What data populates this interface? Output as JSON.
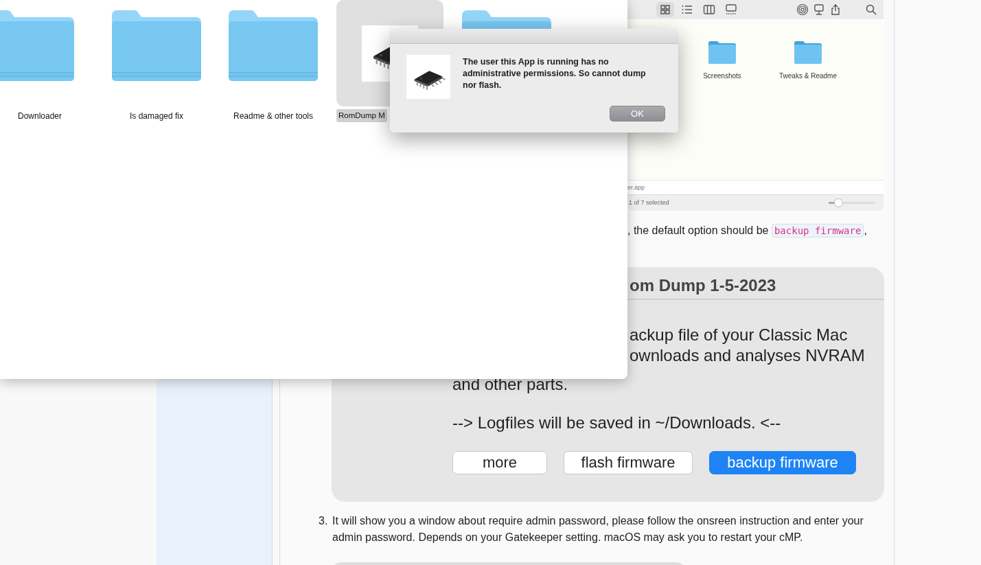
{
  "finder_window": {
    "items": [
      {
        "kind": "folder",
        "label": "Downloader",
        "selected": false
      },
      {
        "kind": "folder",
        "label": "Is damaged fix",
        "selected": false
      },
      {
        "kind": "folder",
        "label": "Readme & other tools",
        "selected": false
      },
      {
        "kind": "app",
        "label": "RomDump M",
        "selected": true
      },
      {
        "kind": "folder",
        "selected": false
      }
    ]
  },
  "alert": {
    "message": "The user this App is running has no administrative permissions. So cannot dump nor flash.",
    "button": "OK"
  },
  "article": {
    "finder_screenshot": {
      "view_buttons": [
        {
          "kind": "grid",
          "selected": true
        },
        {
          "kind": "list",
          "selected": false
        },
        {
          "kind": "columns",
          "selected": false
        },
        {
          "kind": "gallery",
          "selected": false
        }
      ],
      "items": [
        {
          "label": "Screenshots"
        },
        {
          "label": "Tweaks & Readme"
        }
      ],
      "path": "er.app",
      "status": "1 of 7 selected",
      "icon_size": {
        "level": 0.2
      }
    },
    "paragraph": {
      "text_before": ", the default option should be ",
      "code": "backup firmware",
      "text_after": ","
    },
    "romdump_window": {
      "title": "om Dump 1-5-2023",
      "lines": [
        "ackup file of your Classic Mac",
        "ownloads and analyses NVRAM"
      ],
      "line_after": "and other parts.",
      "note": "--> Logfiles will be saved in ~/Downloads.  <--",
      "buttons": [
        {
          "label": "more",
          "default": false
        },
        {
          "label": "flash firmware",
          "default": false
        },
        {
          "label": "backup firmware",
          "default": true
        }
      ]
    },
    "steps": [
      {
        "number": "3.",
        "text": "It will show you a window about require admin password, please follow the onsreen instruction and enter your admin password. Depends on your Gatekeeper setting. macOS may ask you to restart your cMP."
      }
    ]
  }
}
